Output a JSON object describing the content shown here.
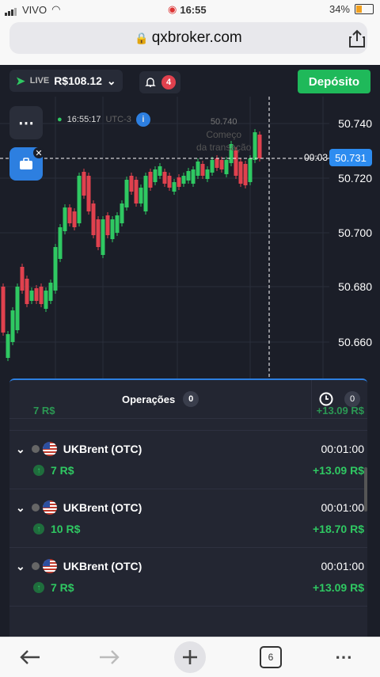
{
  "status_bar": {
    "carrier": "VIVO",
    "time": "16:55",
    "battery": "34%"
  },
  "browser": {
    "url": "qxbroker.com",
    "tabs_count": "6"
  },
  "header": {
    "mode": "LIVE",
    "balance": "R$108.12",
    "notifications": "4",
    "deposit_label": "Depósito"
  },
  "chart": {
    "clock": "16:55:17",
    "timezone": "UTC-3",
    "price_labels": [
      "50.740",
      "50.720",
      "50.700",
      "50.680",
      "50.660"
    ],
    "current_price": "50.731",
    "countdown": "00:03",
    "ghost_line1": "50.740",
    "ghost_line2": "Começo",
    "ghost_line3": "da transação"
  },
  "panel": {
    "tab_operations": "Operações",
    "operations_count": "0",
    "history_count": "0",
    "partial_amount": "7 R$",
    "partial_profit": "+13.09 R$",
    "trades": [
      {
        "asset": "UKBrent (OTC)",
        "duration": "00:01:00",
        "amount": "7 R$",
        "profit": "+13.09 R$"
      },
      {
        "asset": "UKBrent (OTC)",
        "duration": "00:01:00",
        "amount": "10 R$",
        "profit": "+18.70 R$"
      },
      {
        "asset": "UKBrent (OTC)",
        "duration": "00:01:00",
        "amount": "7 R$",
        "profit": "+13.09 R$"
      }
    ]
  },
  "colors": {
    "up": "#2fc862",
    "down": "#e0414e",
    "accent": "#2d8cf0",
    "deposit": "#1fb95a"
  }
}
